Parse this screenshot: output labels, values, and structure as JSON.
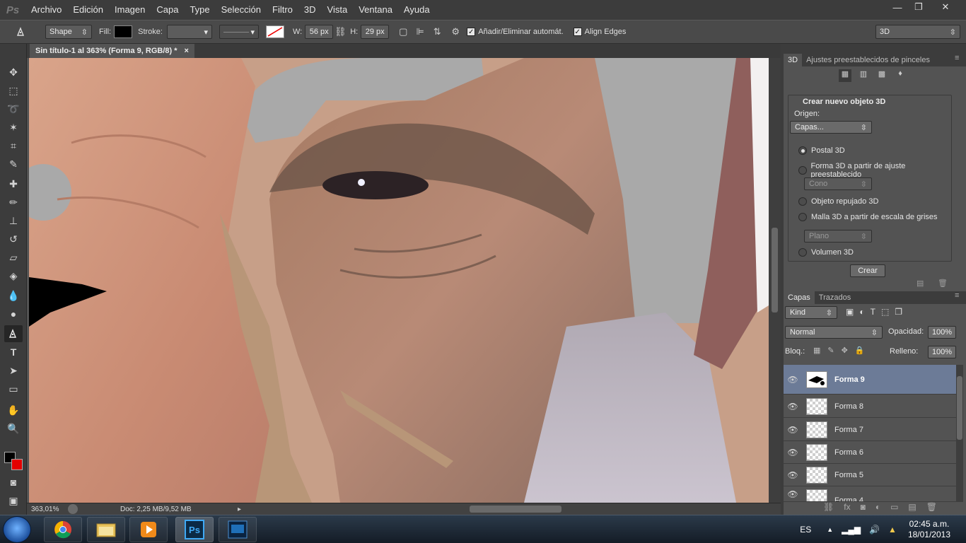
{
  "app": {
    "logo": "Ps"
  },
  "menu": [
    "Archivo",
    "Edición",
    "Imagen",
    "Capa",
    "Type",
    "Selección",
    "Filtro",
    "3D",
    "Vista",
    "Ventana",
    "Ayuda"
  ],
  "window_controls": {
    "minimize": "—",
    "restore": "❐",
    "close": "✕"
  },
  "options": {
    "tool_mode": "Shape",
    "fill_label": "Fill:",
    "fill_color": "#000000",
    "stroke_label": "Stroke:",
    "w_label": "W:",
    "w_value": "56 px",
    "h_label": "H:",
    "h_value": "29 px",
    "auto_add_label": "Añadir/Eliminar automát.",
    "align_edges_label": "Align Edges",
    "workspace": "3D"
  },
  "document": {
    "tab_title": "Sin título-1 al 363% (Forma 9, RGB/8) *",
    "close": "×"
  },
  "status": {
    "zoom": "363,01%",
    "doc_size": "Doc: 2,25 MB/9,52 MB"
  },
  "colors": {
    "foreground": "#000000",
    "background": "#e30000"
  },
  "panel3d": {
    "tab_3d": "3D",
    "tab_presets": "Ajustes preestablecidos de pinceles",
    "section_title": "Crear nuevo objeto 3D",
    "origin_label": "Origen:",
    "origin_value": "Capas...",
    "options": [
      {
        "label": "Postal 3D",
        "selected": true
      },
      {
        "label": "Forma 3D a partir de ajuste preestablecido",
        "selected": false
      },
      {
        "label": "Objeto repujado 3D",
        "selected": false
      },
      {
        "label": "Malla 3D a partir de escala de grises",
        "selected": false
      },
      {
        "label": "Volumen 3D",
        "selected": false
      }
    ],
    "preset_value": "Cono",
    "mesh_value": "Plano",
    "create_button": "Crear"
  },
  "layers_panel": {
    "tab_layers": "Capas",
    "tab_paths": "Trazados",
    "kind_filter": "Kind",
    "blend_mode": "Normal",
    "opacity_label": "Opacidad:",
    "opacity_value": "100%",
    "lock_label": "Bloq.:",
    "fill_label": "Relleno:",
    "fill_value": "100%",
    "layers": [
      "Forma 9",
      "Forma 8",
      "Forma 7",
      "Forma 6",
      "Forma 5",
      "Forma 4"
    ],
    "selected_layer": "Forma 9"
  },
  "taskbar": {
    "language": "ES",
    "time": "02:45 a.m.",
    "date": "18/01/2013",
    "ps_label": "Ps"
  }
}
